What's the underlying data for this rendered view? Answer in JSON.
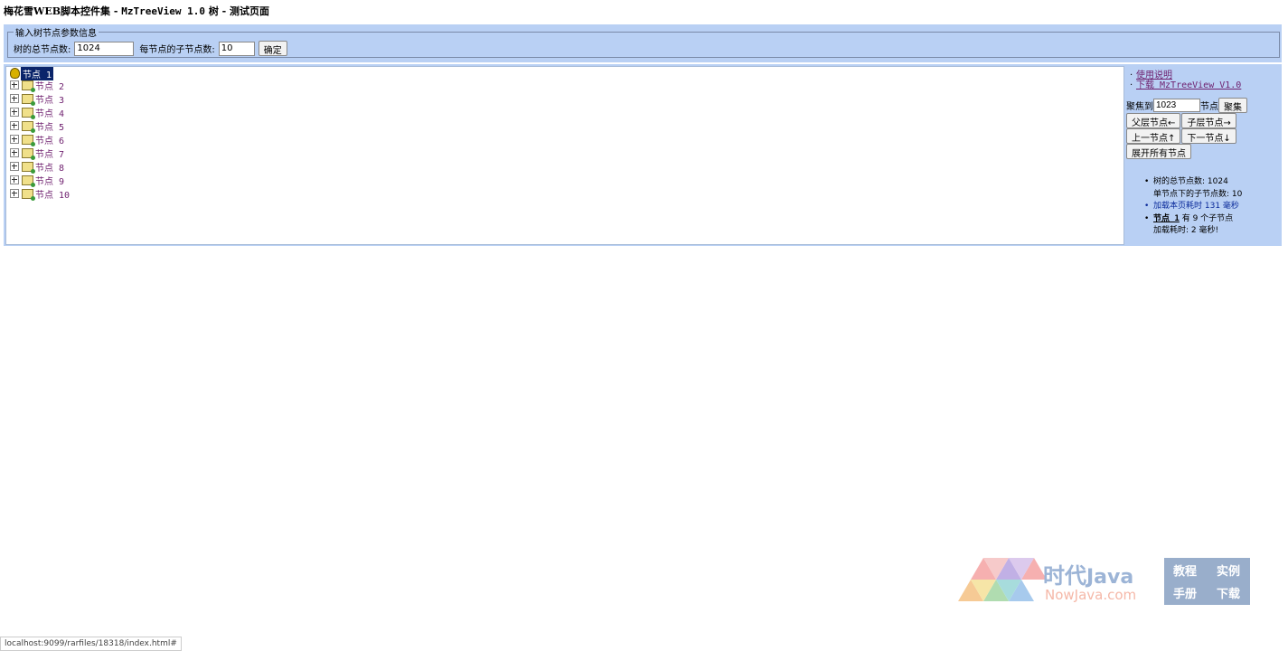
{
  "page": {
    "title_prefix": "梅花雪WEB脚本控件集 - ",
    "title_mono": "MzTreeView 1.0",
    "title_suffix": " 树 - 测试页面"
  },
  "params": {
    "legend": "输入树节点参数信息",
    "total_label": "树的总节点数:",
    "total_value": "1024",
    "children_label": "每节点的子节点数:",
    "children_value": "10",
    "confirm_label": "确定"
  },
  "tree": {
    "root_label": "节点 1",
    "nodes": [
      "节点 2",
      "节点 3",
      "节点 4",
      "节点 5",
      "节点 6",
      "节点 7",
      "节点 8",
      "节点 9",
      "节点 10"
    ]
  },
  "side": {
    "link_usage": "使用说明",
    "link_download": "下载 MzTreeView V1.0",
    "focus_prefix": "聚焦到",
    "focus_value": "1023",
    "focus_suffix": "节点",
    "focus_button": "聚集",
    "parent_button": "父层节点←",
    "child_button": "子层节点→",
    "prev_button": "上一节点↑",
    "next_button": "下一节点↓",
    "expand_all_button": "展开所有节点",
    "stat_total": "树的总节点数: 1024",
    "stat_children": "单节点下的子节点数: 10",
    "stat_load": "加载本页耗时 131 毫秒",
    "stat_node_name": "节点 1",
    "stat_node_has": " 有 9 个子节点",
    "stat_node_time": "加载耗时: 2 毫秒!"
  },
  "logo": {
    "brand_cn": "时代",
    "brand_en": "Java",
    "domain": "NowJava.com",
    "tags": [
      "教程",
      "实例",
      "手册",
      "下载"
    ]
  },
  "status_bar": {
    "url": "localhost:9099/rarfiles/18318/index.html#"
  }
}
